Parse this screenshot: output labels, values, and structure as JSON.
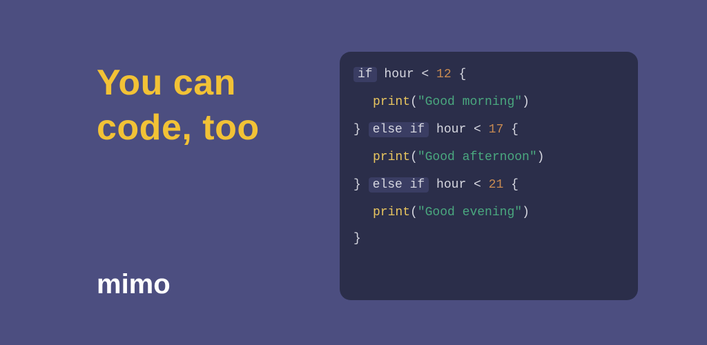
{
  "headline_line1": "You can",
  "headline_line2": "code, too",
  "brand": "mimo",
  "code": {
    "if_kw": "if",
    "else_if_kw": "else if",
    "hour_lt_12_a": " hour ",
    "lt12_lt": "< ",
    "lt12_num": "12",
    "lt12_brace": " {",
    "print_good_morning_fn": "print",
    "print_good_morning_open": "(",
    "print_good_morning_str": "\"Good morning\"",
    "print_good_morning_close": ")",
    "close_open_brace_17": "} ",
    "hour_lt_17_a": " hour ",
    "lt17_lt": "< ",
    "lt17_num": "17",
    "lt17_brace": " {",
    "print_good_afternoon_fn": "print",
    "print_good_afternoon_open": "(",
    "print_good_afternoon_str": "\"Good afternoon\"",
    "print_good_afternoon_close": ")",
    "close_open_brace_21": "} ",
    "hour_lt_21_a": " hour ",
    "lt21_lt": "< ",
    "lt21_num": "21",
    "lt21_brace": " {",
    "print_good_evening_fn": "print",
    "print_good_evening_open": "(",
    "print_good_evening_str": "\"Good evening\"",
    "print_good_evening_close": ")",
    "final_close": "}"
  }
}
